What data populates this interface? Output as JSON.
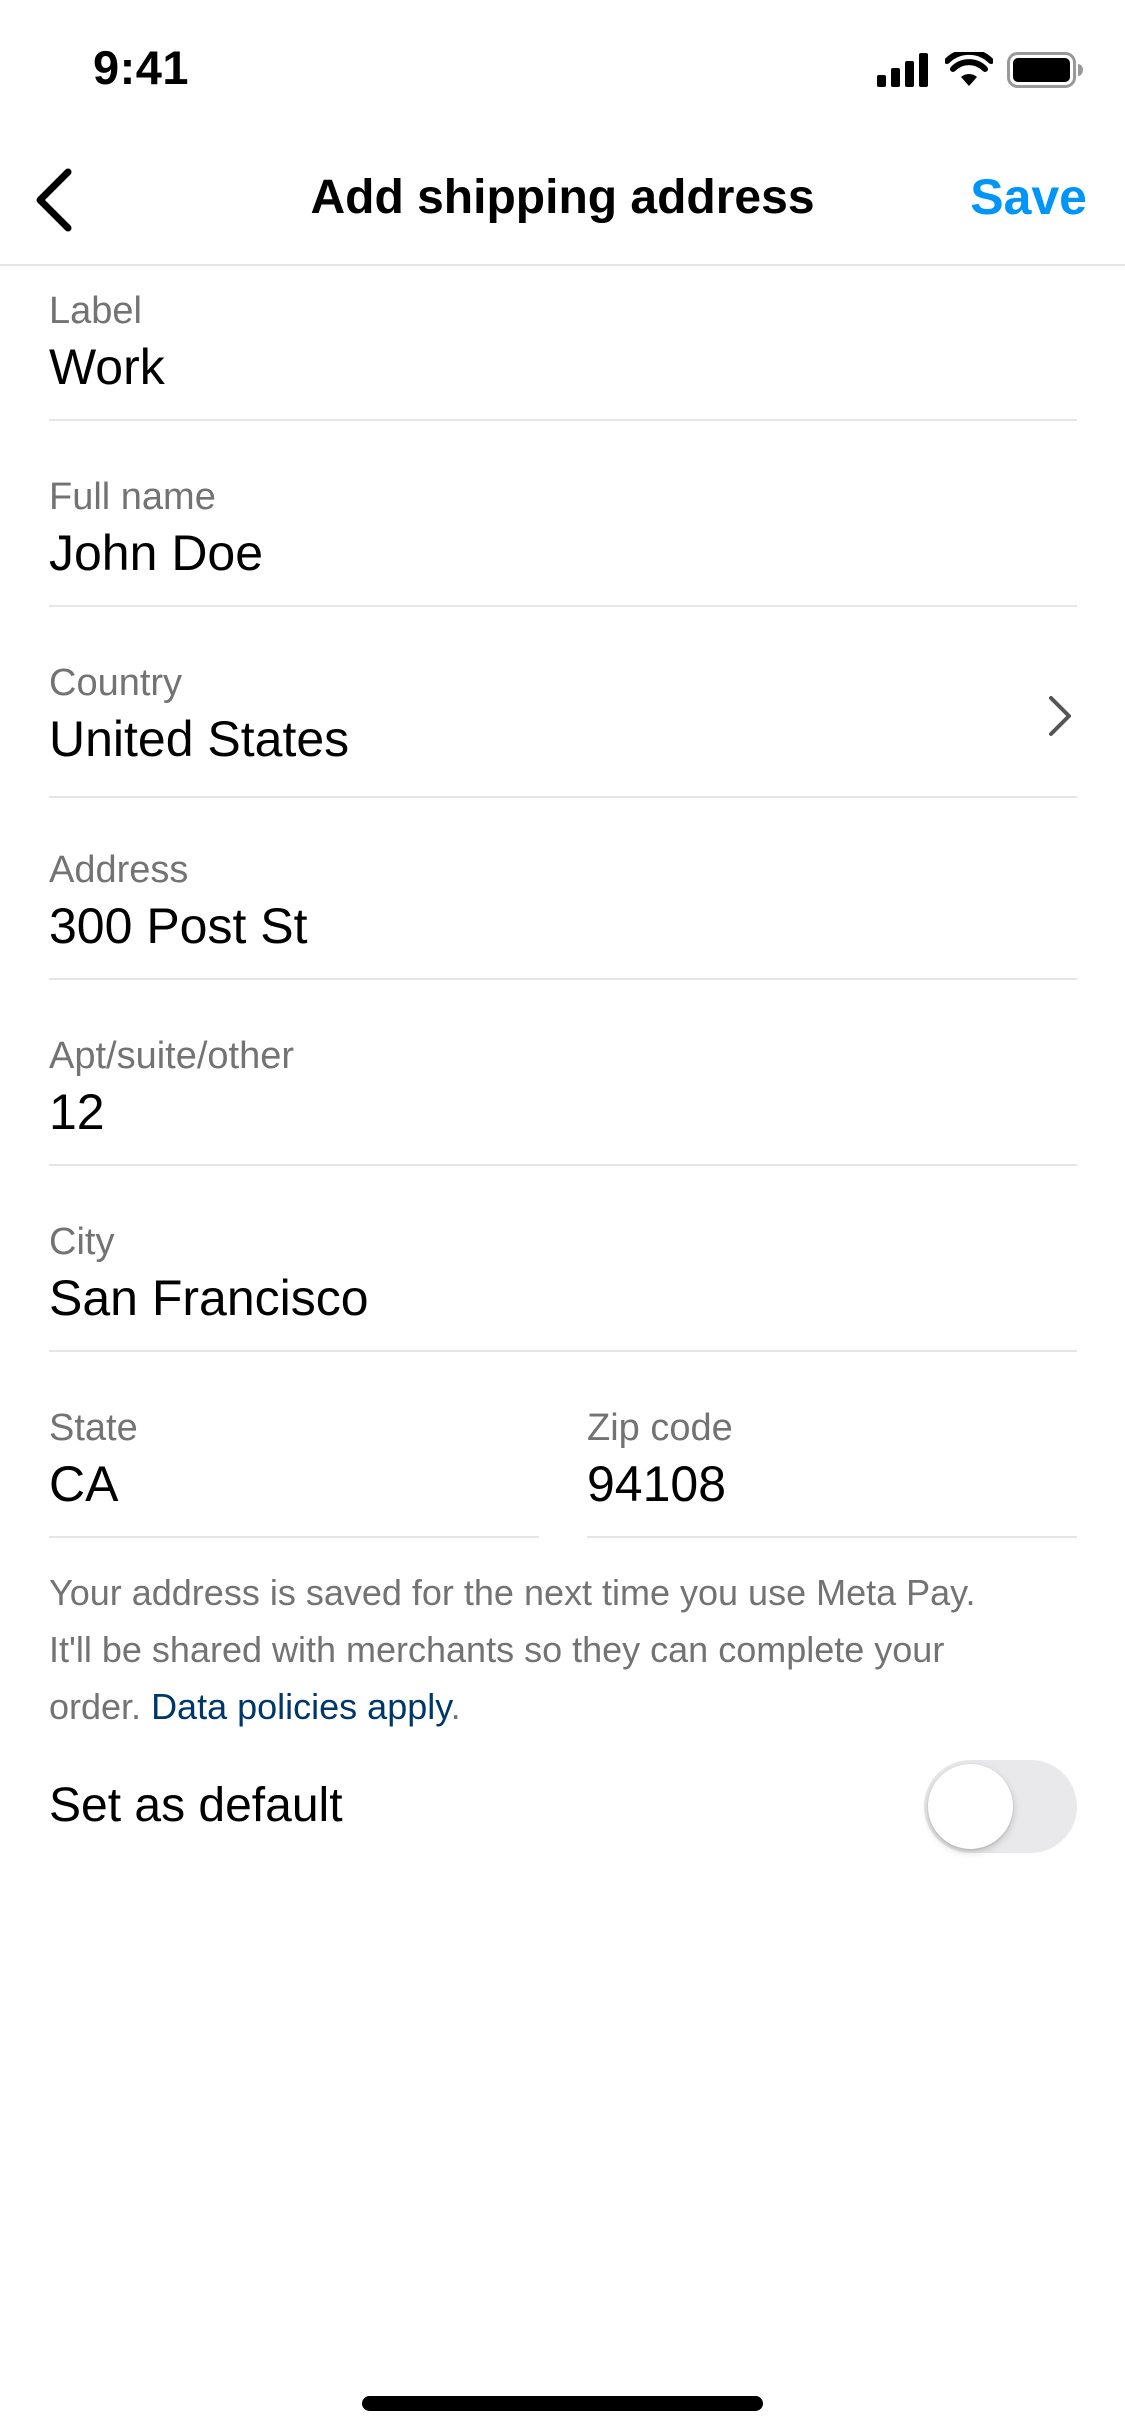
{
  "status_bar": {
    "time": "9:41",
    "icons": [
      "cellular-signal-icon",
      "wifi-icon",
      "battery-icon"
    ]
  },
  "nav": {
    "back_icon": "chevron-left-icon",
    "title": "Add shipping address",
    "save_label": "Save"
  },
  "form": {
    "label": {
      "label": "Label",
      "value": "Work"
    },
    "full_name": {
      "label": "Full name",
      "value": "John Doe"
    },
    "country": {
      "label": "Country",
      "value": "United States",
      "icon": "chevron-right-icon"
    },
    "address": {
      "label": "Address",
      "value": "300 Post St"
    },
    "apt": {
      "label": "Apt/suite/other",
      "value": "12"
    },
    "city": {
      "label": "City",
      "value": "San Francisco"
    },
    "state": {
      "label": "State",
      "value": "CA"
    },
    "zip": {
      "label": "Zip code",
      "value": "94108"
    }
  },
  "disclaimer": {
    "line1": "Your address is saved for the next time you use Meta Pay.",
    "line2": "It'll be shared with merchants so they can complete your",
    "line3_prefix": "order. ",
    "link": "Data policies apply",
    "line3_suffix": "."
  },
  "default_toggle": {
    "label": "Set as default",
    "on": false
  },
  "colors": {
    "accent": "#0095f6",
    "link": "#00376b",
    "secondary_text": "#737373",
    "divider": "#e6e6e6",
    "toggle_off": "#e9e9eb"
  }
}
